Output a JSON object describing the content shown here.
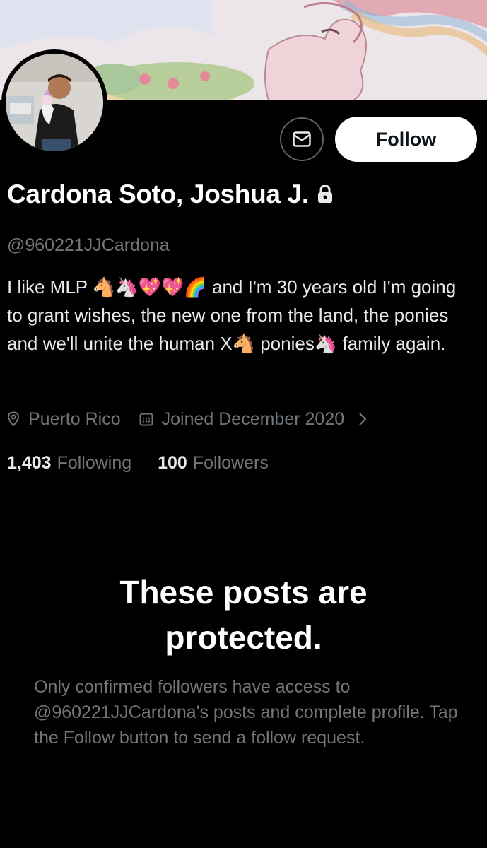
{
  "profile": {
    "display_name": "Cardona Soto, Joshua J.",
    "handle": "@960221JJCardona",
    "bio": "I like MLP 🐴🦄💖💖🌈 and I'm 30 years old I'm going to grant wishes, the new one from the land, the ponies and we'll unite the human X🐴 ponies🦄 family again.",
    "location": "Puerto Rico",
    "joined": "Joined December 2020",
    "following_count": "1,403",
    "following_label": "Following",
    "followers_count": "100",
    "followers_label": "Followers"
  },
  "actions": {
    "follow_label": "Follow",
    "message_icon": "envelope-icon"
  },
  "icons": {
    "lock": "lock-icon",
    "location": "location-pin-icon",
    "calendar": "calendar-icon",
    "chevron": "chevron-right-icon"
  },
  "protected": {
    "title_line1": "These posts are",
    "title_line2": "protected.",
    "description": "Only confirmed followers have access to @960221JJCardona's posts and complete profile. Tap the Follow button to send a follow request."
  },
  "colors": {
    "background": "#000000",
    "secondary_text": "#71767b",
    "primary_text": "#e7e9ea",
    "follow_button_bg": "#ffffff"
  }
}
